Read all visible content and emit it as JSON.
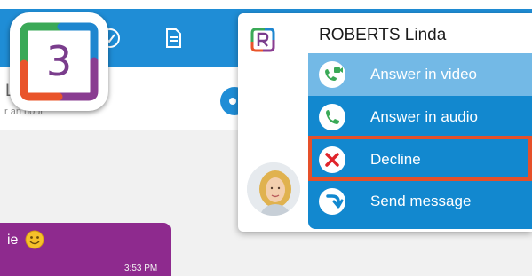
{
  "background": {
    "contact_initial": "L",
    "contact_status": "r an hour",
    "message_text": "ie",
    "message_time": "3:53 PM",
    "icons": [
      "check-circle-icon",
      "document-icon",
      "call-icon"
    ]
  },
  "badge": {
    "number": "3"
  },
  "call_popup": {
    "caller_name": "ROBERTS Linda",
    "actions": [
      {
        "label": "Answer in video",
        "icon": "video-call-icon"
      },
      {
        "label": "Answer in audio",
        "icon": "phone-icon"
      },
      {
        "label": "Decline",
        "icon": "decline-x-icon",
        "highlighted_border": "#e5502a"
      },
      {
        "label": "Send message",
        "icon": "send-message-icon"
      }
    ]
  },
  "colors": {
    "topbar": "#1f8dd6",
    "menu": "#1288cf",
    "menu_highlight": "#73b9e6",
    "bubble": "#8e2a8e",
    "badge_number": "#7a3d8c",
    "decline_border": "#e5502a"
  }
}
